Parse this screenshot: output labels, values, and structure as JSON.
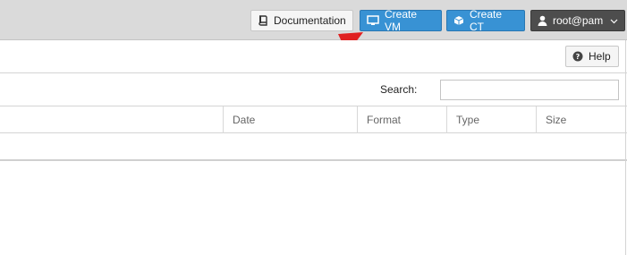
{
  "header": {
    "documentation_label": "Documentation",
    "create_vm_label": "Create VM",
    "create_ct_label": "Create CT",
    "user_label": "root@pam"
  },
  "toolbar": {
    "help_label": "Help"
  },
  "search": {
    "label": "Search:",
    "value": ""
  },
  "grid": {
    "columns": [
      "",
      "Date",
      "Format",
      "Type",
      "Size"
    ]
  },
  "colors": {
    "accent": "#3892d4",
    "user_button": "#4d4d4d",
    "arrow": "#e02020"
  },
  "icons": [
    "book-icon",
    "monitor-icon",
    "cube-icon",
    "user-icon",
    "chevron-down-icon",
    "help-icon"
  ]
}
